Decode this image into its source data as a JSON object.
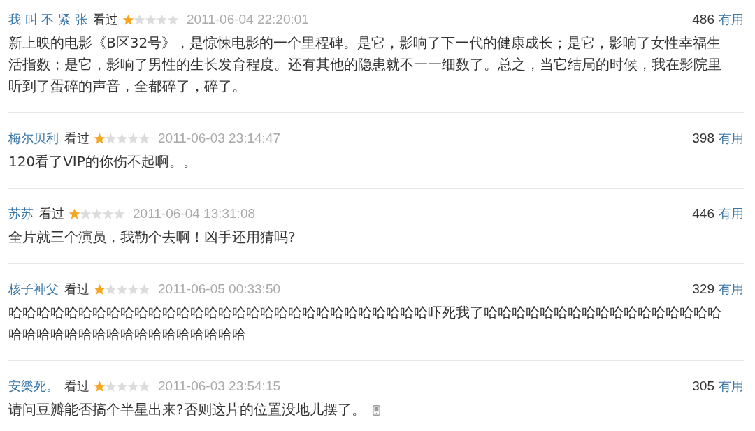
{
  "reviews": [
    {
      "user": "我 叫 不 紧 张",
      "status": "看过",
      "stars": 1,
      "time": "2011-06-04 22:20:01",
      "votes": "486",
      "useful": "有用",
      "text": "新上映的电影《B区32号》，是惊悚电影的一个里程碑。是它，影响了下一代的健康成长；是它，影响了女性幸福生活指数；是它，影响了男性的生长发育程度。还有其他的隐患就不一一细数了。总之，当它结局的时候，我在影院里听到了蛋碎的声音，全都碎了，碎了。",
      "mobile": false
    },
    {
      "user": "梅尔贝利",
      "status": "看过",
      "stars": 1,
      "time": "2011-06-03 23:14:47",
      "votes": "398",
      "useful": "有用",
      "text": "120看了VIP的你伤不起啊。。",
      "mobile": false
    },
    {
      "user": "苏苏",
      "status": "看过",
      "stars": 1,
      "time": "2011-06-04 13:31:08",
      "votes": "446",
      "useful": "有用",
      "text": "全片就三个演员，我勒个去啊！凶手还用猜吗?",
      "mobile": false
    },
    {
      "user": "核子神父",
      "status": "看过",
      "stars": 1,
      "time": "2011-06-05 00:33:50",
      "votes": "329",
      "useful": "有用",
      "text": "哈哈哈哈哈哈哈哈哈哈哈哈哈哈哈哈哈哈哈哈哈哈哈哈哈哈哈哈哈哈吓死我了哈哈哈哈哈哈哈哈哈哈哈哈哈哈哈哈哈哈哈哈哈哈哈哈哈哈哈哈哈哈哈哈哈哈",
      "mobile": false
    },
    {
      "user": "安樂死。",
      "status": "看过",
      "stars": 1,
      "time": "2011-06-03 23:54:15",
      "votes": "305",
      "useful": "有用",
      "text": "请问豆瓣能否搞个半星出来?否则这片的位置没地儿摆了。",
      "mobile": true
    }
  ]
}
